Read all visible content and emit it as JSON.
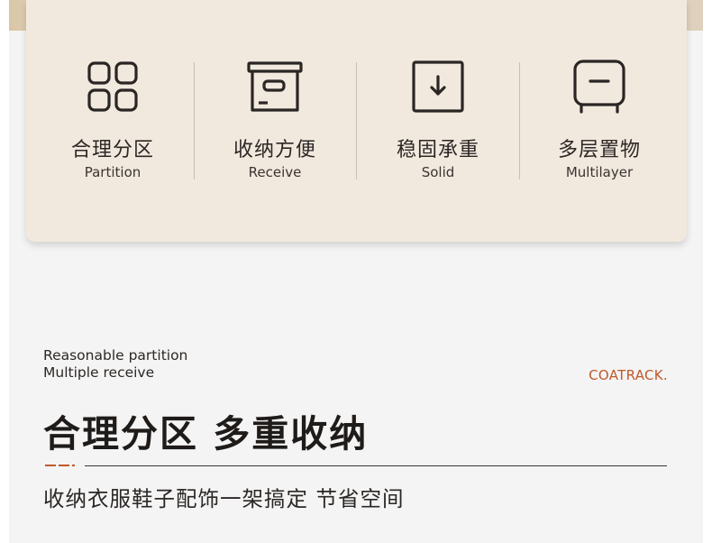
{
  "features": [
    {
      "cn": "合理分区",
      "en": "Partition",
      "icon": "grid-icon"
    },
    {
      "cn": "收纳方便",
      "en": "Receive",
      "icon": "storage-box-icon"
    },
    {
      "cn": "稳固承重",
      "en": "Solid",
      "icon": "download-box-icon"
    },
    {
      "cn": "多层置物",
      "en": "Multilayer",
      "icon": "shelf-stand-icon"
    }
  ],
  "section": {
    "en_line1": "Reasonable partition",
    "en_line2": "Multiple receive",
    "brand": "COATRACK.",
    "headline": "合理分区 多重收纳",
    "tagline": "收纳衣服鞋子配饰一架搞定 节省空间"
  },
  "colors": {
    "card_bg": "#f2e9de",
    "accent": "#c0592a",
    "icon_stroke": "#2a2624"
  }
}
